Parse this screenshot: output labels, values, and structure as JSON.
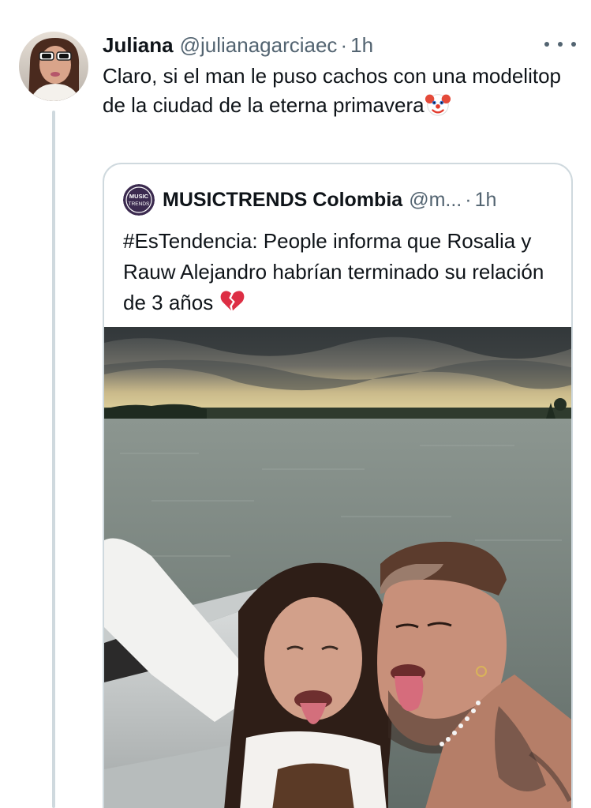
{
  "author": {
    "name": "Juliana",
    "handle": "@julianagarciaec",
    "separator": "·",
    "time": "1h",
    "avatar": "avatar-photo"
  },
  "tweet": {
    "text": "Claro, si el man le puso cachos con una modelitop de la ciudad de la eterna primavera",
    "emoji": "clown-face"
  },
  "quoted": {
    "name": "MUSICTRENDS Colombia",
    "handle": "@m...",
    "separator": "·",
    "time": "1h",
    "avatar_logo": "MUSIC TRENDS",
    "text": "#EsTendencia: People informa que Rosalia y Rauw Alejandro habrían terminado su relación de 3 años",
    "emoji": "broken-heart",
    "image": "couple-selfie-on-boat-photo"
  },
  "colors": {
    "text": "#0f1419",
    "secondary": "#536471",
    "border": "#cfd9de",
    "logo_purple": "#3b2a4f"
  },
  "icons": {
    "more": "more-horizontal-icon"
  }
}
